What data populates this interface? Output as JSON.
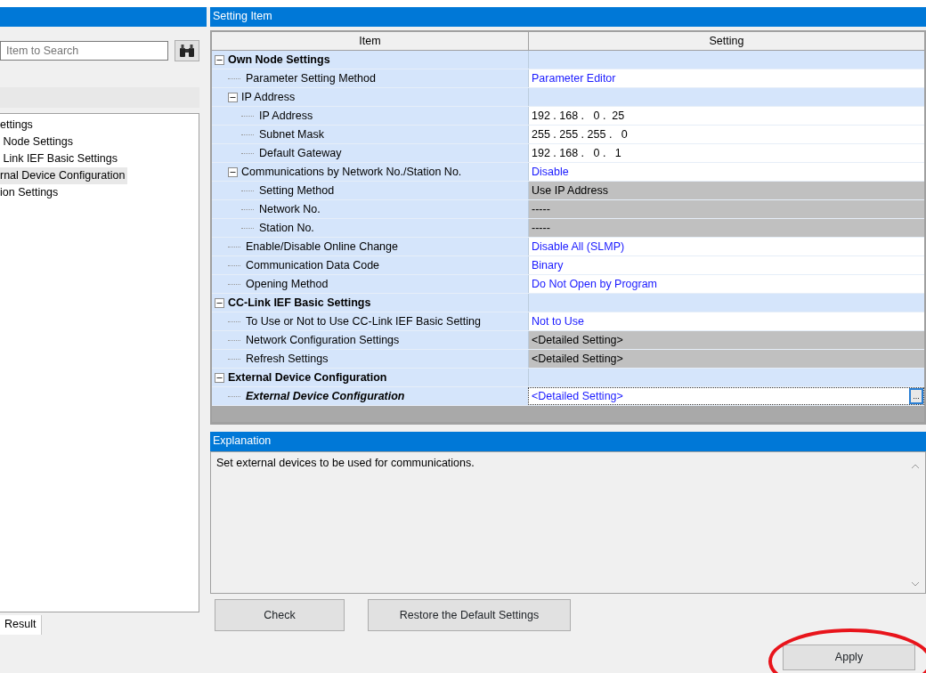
{
  "left_panel": {
    "search": {
      "placeholder": "Item to Search"
    },
    "tree": [
      {
        "label": "ettings",
        "selected": false
      },
      {
        "label": " Node Settings",
        "selected": false
      },
      {
        "label": " Link IEF Basic Settings",
        "selected": false
      },
      {
        "label": "rnal Device Configuration",
        "selected": true
      },
      {
        "label": "ion Settings",
        "selected": false
      }
    ],
    "tabs": [
      {
        "label": "Result",
        "selected": true
      }
    ]
  },
  "setting_item": {
    "title": "Setting Item",
    "columns": [
      "Item",
      "Setting"
    ],
    "rows": [
      {
        "label": "Own Node Settings",
        "expanded": true,
        "selected": false,
        "children": [
          {
            "label": "Parameter Setting Method",
            "value": "Parameter Editor",
            "kind": "select",
            "selected": false
          },
          {
            "label": "IP Address",
            "expanded": true,
            "selected": false,
            "children": [
              {
                "label": "IP Address",
                "value": "192 . 168 .   0 .  25",
                "kind": "text",
                "selected": false
              },
              {
                "label": "Subnet Mask",
                "value": "255 . 255 . 255 .   0",
                "kind": "text",
                "selected": false
              },
              {
                "label": "Default Gateway",
                "value": "192 . 168 .   0 .   1",
                "kind": "text",
                "selected": false
              }
            ]
          },
          {
            "label": "Communications by Network No./Station No.",
            "value": "Disable",
            "kind": "select",
            "expanded": true,
            "selected": false,
            "children": [
              {
                "label": "Setting Method",
                "value": "Use IP Address",
                "kind": "locked",
                "selected": false
              },
              {
                "label": "Network No.",
                "value": "-----",
                "kind": "locked",
                "selected": false
              },
              {
                "label": "Station No.",
                "value": "-----",
                "kind": "locked",
                "selected": false
              }
            ]
          },
          {
            "label": "Enable/Disable Online Change",
            "value": "Disable All (SLMP)",
            "kind": "select",
            "selected": false
          },
          {
            "label": "Communication Data Code",
            "value": "Binary",
            "kind": "select",
            "selected": false
          },
          {
            "label": "Opening Method",
            "value": "Do Not Open by Program",
            "kind": "select",
            "selected": false
          }
        ]
      },
      {
        "label": "CC-Link IEF Basic Settings",
        "expanded": true,
        "selected": false,
        "children": [
          {
            "label": "To Use or Not to Use CC-Link IEF Basic Setting",
            "value": "Not to Use",
            "kind": "select",
            "selected": false
          },
          {
            "label": "Network Configuration Settings",
            "value": "<Detailed Setting>",
            "kind": "locked",
            "selected": false
          },
          {
            "label": "Refresh Settings",
            "value": "<Detailed Setting>",
            "kind": "locked",
            "selected": false
          }
        ]
      },
      {
        "label": "External Device Configuration",
        "expanded": true,
        "selected": false,
        "children": [
          {
            "label": "External Device Configuration",
            "value": "<Detailed Setting>",
            "kind": "select",
            "selected": true,
            "browse_button": "..."
          }
        ]
      }
    ]
  },
  "explanation": {
    "title": "Explanation",
    "text": "Set external devices to be used for communications."
  },
  "buttons": [
    "Check",
    "Restore the Default Settings"
  ],
  "apply_button": "Apply",
  "annotations": [
    {
      "kind": "ellipse"
    }
  ]
}
